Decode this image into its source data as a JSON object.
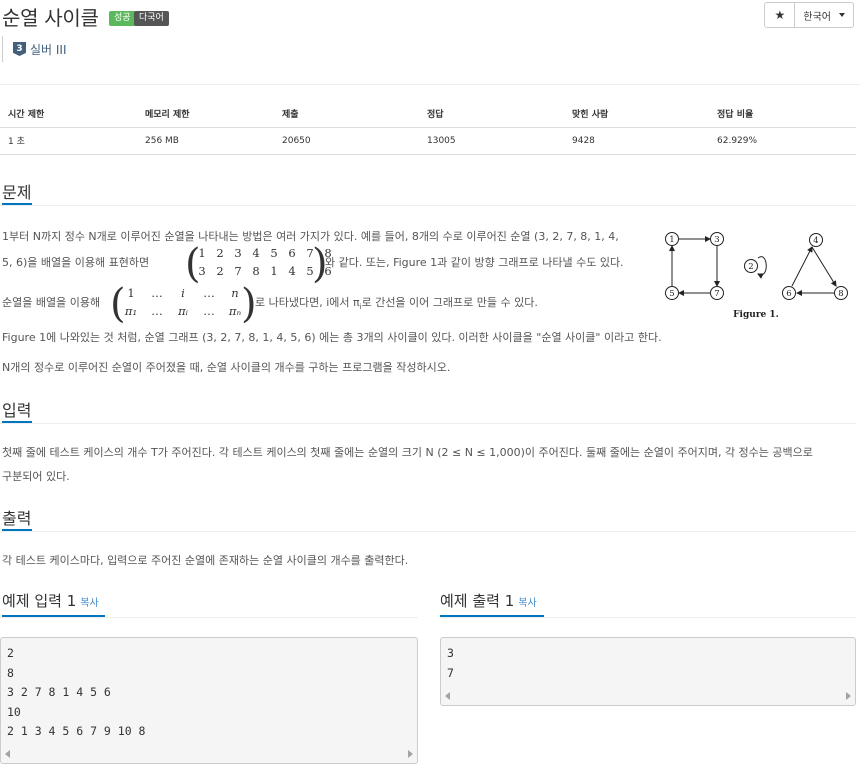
{
  "header": {
    "title": "순열 사이클",
    "badge_success": "성공",
    "badge_multilang": "다국어",
    "star_icon": "★",
    "language": "한국어",
    "tier_num": "3",
    "tier_text": "실버 III"
  },
  "info": {
    "headers": [
      "시간 제한",
      "메모리 제한",
      "제출",
      "정답",
      "맞힌 사람",
      "정답 비율"
    ],
    "values": [
      "1 초",
      "256 MB",
      "20650",
      "13005",
      "9428",
      "62.929%"
    ]
  },
  "problem": {
    "heading": "문제",
    "line1": "1부터 N까지 정수 N개로 이루어진 순열을 나타내는 방법은 여러 가지가 있다. 예를 들어, 8개의 수로 이루어진 순열 (3, 2, 7, 8, 1, 4,",
    "line2a": "5, 6)을 배열을 이용해 표현하면",
    "line2b": "와 같다. 또는, Figure 1과 같이 방향 그래프로 나타낼 수도 있다.",
    "matrix_top": [
      "1",
      "2",
      "3",
      "4",
      "5",
      "6",
      "7",
      "8"
    ],
    "matrix_bottom": [
      "3",
      "2",
      "7",
      "8",
      "1",
      "4",
      "5",
      "6"
    ],
    "line3a": "순열을 배열을 이용해",
    "line3b": "로 나타냈다면, i에서 π",
    "line3c": "로 간선을 이어 그래프로 만들 수 있다.",
    "gen_top": [
      "1",
      "…",
      "i",
      "…",
      "n"
    ],
    "gen_bottom": [
      "π₁",
      "…",
      "πᵢ",
      "…",
      "πₙ"
    ],
    "line4": "Figure 1에 나와있는 것 처럼, 순열 그래프 (3, 2, 7, 8, 1, 4, 5, 6) 에는 총 3개의 사이클이 있다. 이러한 사이클을 \"순열 사이클\" 이라고 한다.",
    "line5": "N개의 정수로 이루어진 순열이 주어졌을 때, 순열 사이클의 개수를 구하는 프로그램을 작성하시오.",
    "figure_nodes": [
      "1",
      "3",
      "5",
      "7",
      "2",
      "4",
      "6",
      "8"
    ],
    "figure_caption": "Figure 1."
  },
  "input": {
    "heading": "입력",
    "line1": "첫째 줄에 테스트 케이스의 개수 T가 주어진다. 각 테스트 케이스의 첫째 줄에는 순열의 크기 N (2 ≤ N ≤ 1,000)이 주어진다. 둘째 줄에는 순열이 주어지며, 각 정수는 공백으로",
    "line2": "구분되어 있다."
  },
  "output": {
    "heading": "출력",
    "line1": "각 테스트 케이스마다, 입력으로 주어진 순열에 존재하는 순열 사이클의 개수를 출력한다."
  },
  "samples": {
    "input_title": "예제 입력 1",
    "output_title": "예제 출력 1",
    "copy_label": "복사",
    "input_text": "2\n8\n3 2 7 8 1 4 5 6\n10\n2 1 3 4 5 6 7 9 10 8",
    "output_text": "3\n7"
  }
}
